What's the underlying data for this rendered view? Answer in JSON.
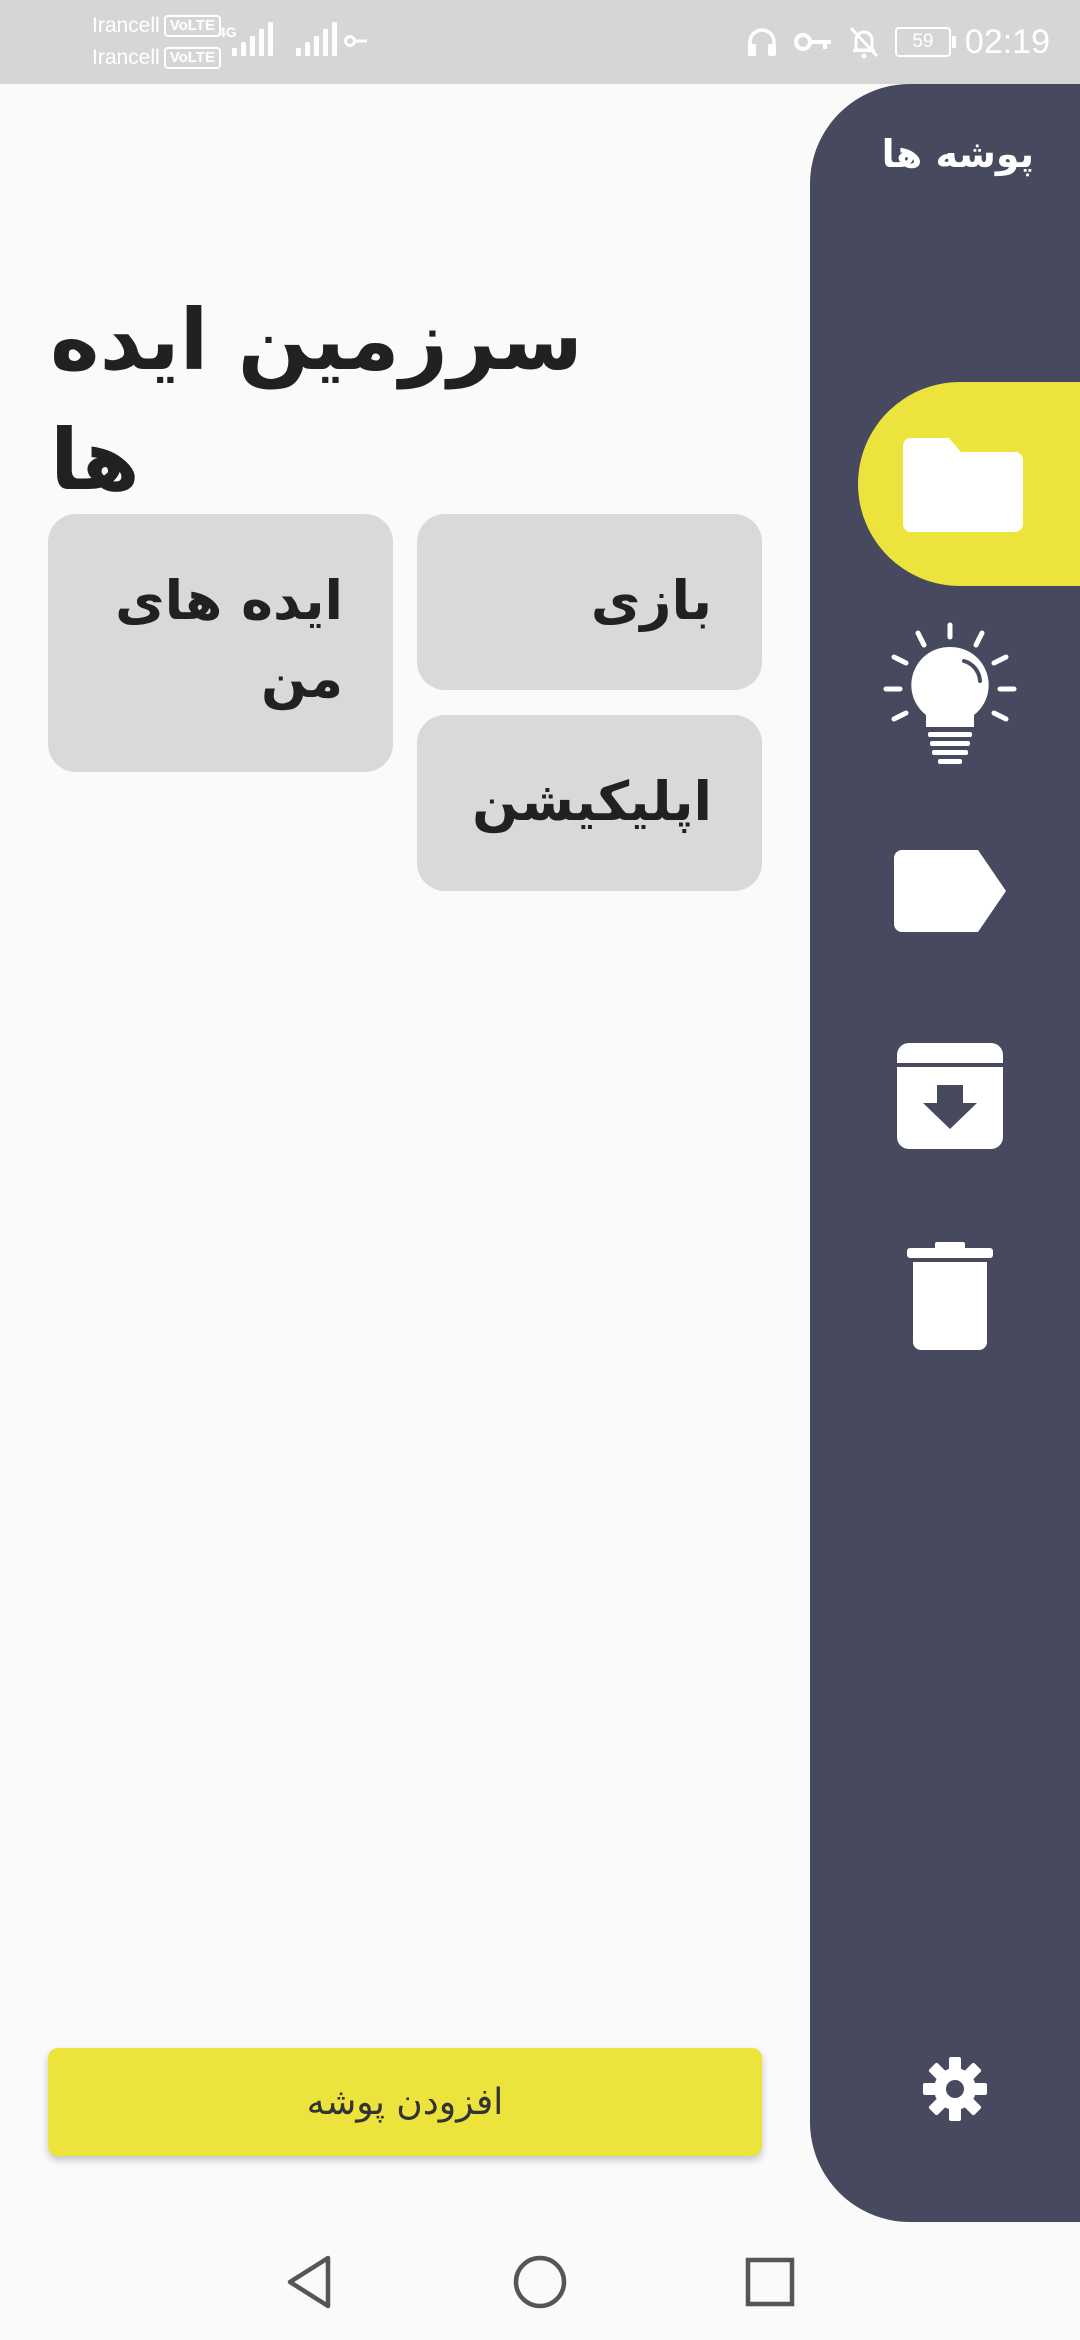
{
  "status_bar": {
    "carrier_1": "Irancell",
    "carrier_2": "Irancell",
    "volte_label": "VoLTE",
    "network_type": "4G",
    "battery_level": "59",
    "time": "02:19",
    "icons": [
      "headphones-icon",
      "vpn-key-icon",
      "notifications-off-icon",
      "battery-icon"
    ]
  },
  "page": {
    "title": "سرزمین ایده ها"
  },
  "folders": [
    {
      "label": "بازی"
    },
    {
      "label": "اپلیکیشن"
    },
    {
      "label": "ایده های من"
    }
  ],
  "add_button": {
    "label": "افزودن پوشه"
  },
  "nav_rail": {
    "title": "پوشه ها",
    "items": [
      {
        "icon": "folder-icon",
        "active": true
      },
      {
        "icon": "lightbulb-icon",
        "active": false
      },
      {
        "icon": "label-icon",
        "active": false
      },
      {
        "icon": "archive-icon",
        "active": false
      },
      {
        "icon": "trash-icon",
        "active": false
      }
    ],
    "settings_icon": "gear-icon"
  },
  "colors": {
    "accent": "#ece43c",
    "rail_background": "#474a5e",
    "card_background": "#d9d9d9",
    "status_bar": "#d6d6d6",
    "page_background": "#fafafa"
  },
  "system_nav": {
    "icons": [
      "back-icon",
      "home-icon",
      "recents-icon"
    ]
  }
}
